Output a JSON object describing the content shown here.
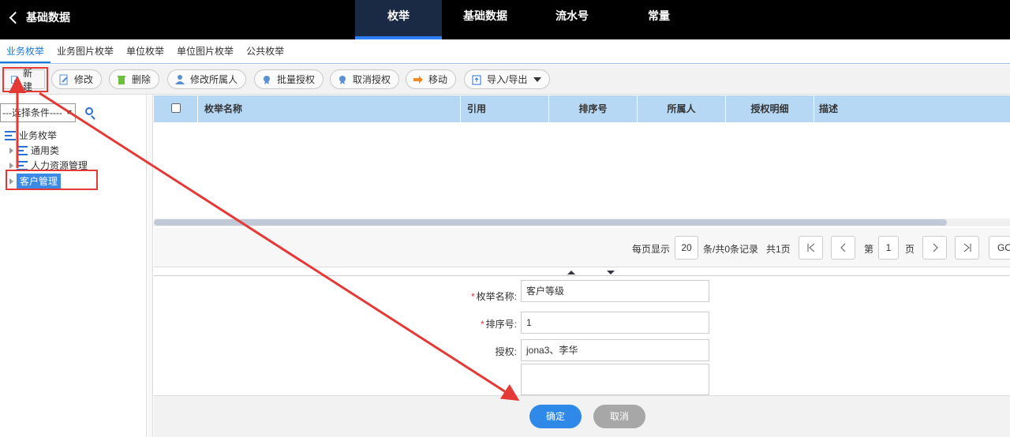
{
  "header": {
    "back_label": "基础数据",
    "tabs": [
      {
        "label": "枚举",
        "active": true
      },
      {
        "label": "基础数据",
        "active": false
      },
      {
        "label": "流水号",
        "active": false
      },
      {
        "label": "常量",
        "active": false
      }
    ]
  },
  "subnav": {
    "items": [
      "业务枚举",
      "业务图片枚举",
      "单位枚举",
      "单位图片枚举",
      "公共枚举"
    ],
    "active_index": 0
  },
  "toolbar": {
    "new": "新建",
    "edit": "修改",
    "delete": "删除",
    "change_owner": "修改所属人",
    "batch_auth": "批量授权",
    "cancel_auth": "取消授权",
    "move": "移动",
    "import_export": "导入/导出"
  },
  "left_panel": {
    "filter_value": "---选择条件----",
    "tree": {
      "root": "业务枚举",
      "children": [
        "通用类",
        "人力资源管理",
        "客户管理"
      ],
      "selected_index": 2
    }
  },
  "grid": {
    "columns": [
      "枚举名称",
      "引用",
      "排序号",
      "所属人",
      "授权明细",
      "描述"
    ]
  },
  "pager": {
    "per_page_label": "每页显示",
    "per_page_value": "20",
    "summary": "条/共0条记录",
    "total_pages": "共1页",
    "page_prefix": "第",
    "page_value": "1",
    "page_suffix": "页",
    "go": "GO"
  },
  "form": {
    "name_label": "枚举名称:",
    "name_value": "客户等级",
    "order_label": "排序号:",
    "order_value": "1",
    "auth_label": "授权:",
    "auth_value": "jona3、李华"
  },
  "footer": {
    "ok": "确定",
    "cancel": "取消"
  },
  "colors": {
    "accent": "#2e89e8",
    "annotation_red": "#e53935",
    "grid_header": "#b6d8f5"
  }
}
